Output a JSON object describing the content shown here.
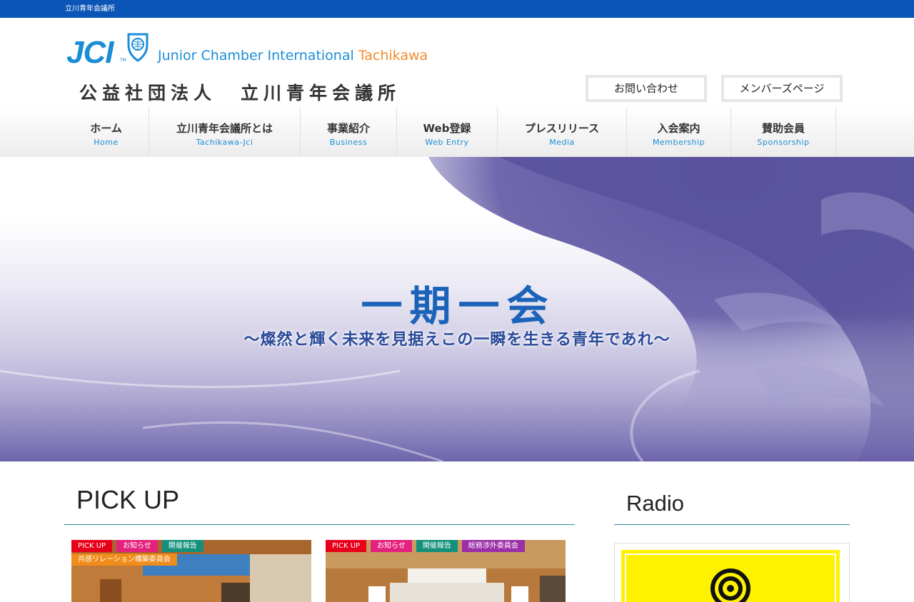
{
  "topbar": {
    "text": "立川青年会議所"
  },
  "logo": {
    "jci": "JCI",
    "tm": "TM",
    "en_main": "Junior Chamber International ",
    "en_city": "Tachikawa",
    "jp_left": "公益社団法人",
    "jp_right": "立川青年会議所"
  },
  "header_buttons": {
    "contact": "お問い合わせ",
    "members": "メンバーズページ"
  },
  "nav": [
    {
      "jp": "ホーム",
      "en": "Home"
    },
    {
      "jp": "立川青年会議所とは",
      "en": "Tachikawa-Jci"
    },
    {
      "jp": "事業紹介",
      "en": "Business"
    },
    {
      "jp": "Web登録",
      "en": "Web Entry"
    },
    {
      "jp": "プレスリリース",
      "en": "Media"
    },
    {
      "jp": "入会案内",
      "en": "Membership"
    },
    {
      "jp": "賛助会員",
      "en": "Sponsorship"
    }
  ],
  "hero": {
    "title": "一期一会",
    "subtitle": "～燦然と輝く未来を見据えこの一瞬を生きる青年であれ～"
  },
  "pickup": {
    "heading": "PICK UP",
    "cards": [
      {
        "tags": [
          "PICK UP",
          "お知らせ",
          "開催報告",
          "共感リレーション構築委員会"
        ]
      },
      {
        "tags": [
          "PICK UP",
          "お知らせ",
          "開催報告",
          "総務渉外委員会"
        ]
      }
    ]
  },
  "radio": {
    "heading": "Radio"
  },
  "colors": {
    "brand_blue": "#0a55b5",
    "accent_blue": "#1a8dd6",
    "orange": "#f28a2c"
  }
}
